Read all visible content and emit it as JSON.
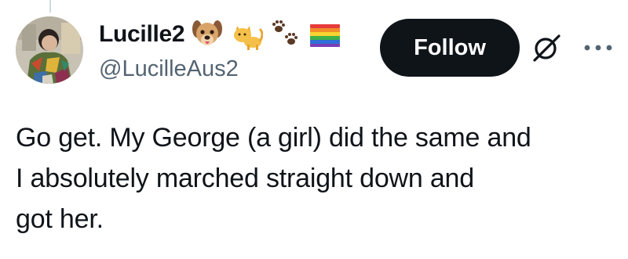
{
  "author": {
    "display_name": "Lucille2",
    "handle": "@LucilleAus2",
    "name_emojis": [
      "dog-face-emoji",
      "cat-emoji",
      "paw-prints-emoji",
      "rainbow-flag-emoji"
    ]
  },
  "actions": {
    "follow_label": "Follow",
    "icons": [
      "grok-icon",
      "more-options-icon"
    ]
  },
  "tweet": {
    "text": "Go get. My George (a girl) did the same and\nI absolutely marched straight down and\ngot her."
  },
  "colors": {
    "text": "#0f1419",
    "secondary_text": "#536471",
    "follow_bg": "#0f1419",
    "follow_text": "#ffffff",
    "thread_line": "#cfd9de"
  }
}
